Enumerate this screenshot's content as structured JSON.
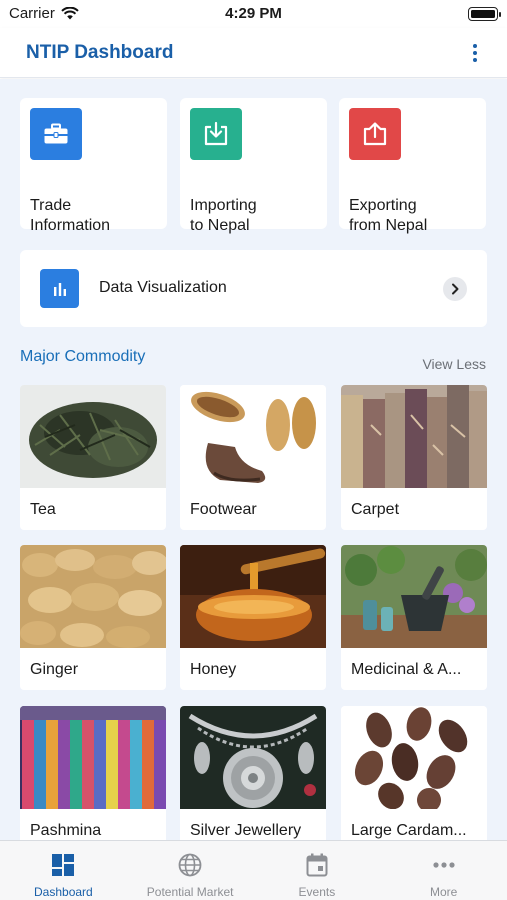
{
  "status_bar": {
    "carrier": "Carrier",
    "time": "4:29 PM"
  },
  "header": {
    "title": "NTIP Dashboard"
  },
  "quick_links": [
    {
      "label_line1": "Trade",
      "label_line2": "Information",
      "icon": "briefcase-icon",
      "color": "#2b7ee0"
    },
    {
      "label_line1": "Importing",
      "label_line2": "to Nepal",
      "icon": "download-icon",
      "color": "#27b08f"
    },
    {
      "label_line1": "Exporting",
      "label_line2": "from Nepal",
      "icon": "upload-icon",
      "color": "#e14848"
    }
  ],
  "data_viz": {
    "label": "Data Visualization",
    "icon": "bar-chart-icon",
    "color": "#2b7ee0"
  },
  "commodities": {
    "title": "Major Commodity",
    "toggle": "View Less",
    "items": [
      {
        "label": "Tea",
        "image": "tea-leaves"
      },
      {
        "label": "Footwear",
        "image": "felt-slippers"
      },
      {
        "label": "Carpet",
        "image": "rolled-carpets"
      },
      {
        "label": "Ginger",
        "image": "ginger-roots"
      },
      {
        "label": "Honey",
        "image": "honey-bowl"
      },
      {
        "label": "Medicinal & A...",
        "image": "herbs-mortar"
      },
      {
        "label": "Pashmina",
        "image": "pashmina-scarves"
      },
      {
        "label": "Silver Jewellery",
        "image": "silver-necklace"
      },
      {
        "label": "Large Cardam...",
        "image": "cardamom-pods"
      }
    ]
  },
  "tab_bar": [
    {
      "label": "Dashboard",
      "icon": "dashboard-icon",
      "active": true
    },
    {
      "label": "Potential Market",
      "icon": "globe-icon",
      "active": false
    },
    {
      "label": "Events",
      "icon": "calendar-icon",
      "active": false
    },
    {
      "label": "More",
      "icon": "more-icon",
      "active": false
    }
  ],
  "colors": {
    "accent": "#1a5fa8",
    "background": "#eef3fb",
    "link": "#1a6fb8"
  }
}
